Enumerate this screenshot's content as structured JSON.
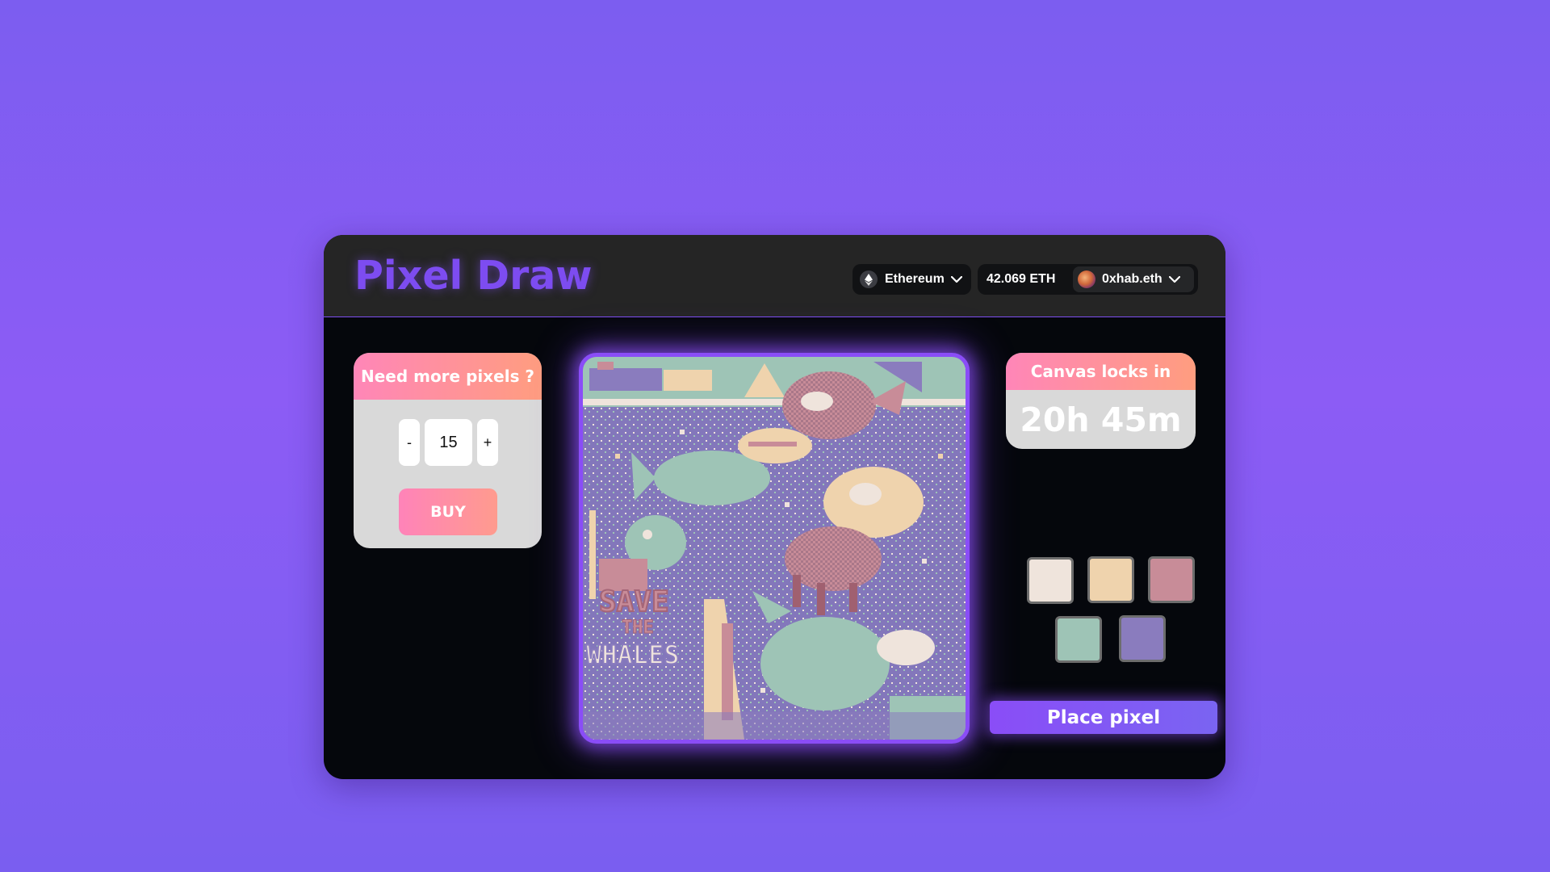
{
  "app": {
    "title": "Pixel Draw"
  },
  "header": {
    "network": {
      "label": "Ethereum",
      "icon": "ethereum-icon"
    },
    "balance": "42.069 ETH",
    "account": {
      "name": "0xhab.eth"
    }
  },
  "buy_panel": {
    "title": "Need more pixels ?",
    "decrement_label": "-",
    "quantity": "15",
    "increment_label": "+",
    "buy_label": "BUY"
  },
  "canvas": {
    "texts": {
      "save": "SAVE",
      "the": "THE",
      "whales": "WHALES"
    }
  },
  "timer": {
    "title": "Canvas locks in",
    "value": "20h 45m"
  },
  "palette": {
    "colors": [
      "#efe4dc",
      "#efd3ad",
      "#c88c98",
      "#9ec4b6",
      "#8a7cbe"
    ]
  },
  "place_button": {
    "label": "Place pixel"
  },
  "colors": {
    "accent": "#8a4df7",
    "gradient_pink": "#ff86b8",
    "gradient_orange": "#ff9d7f"
  }
}
